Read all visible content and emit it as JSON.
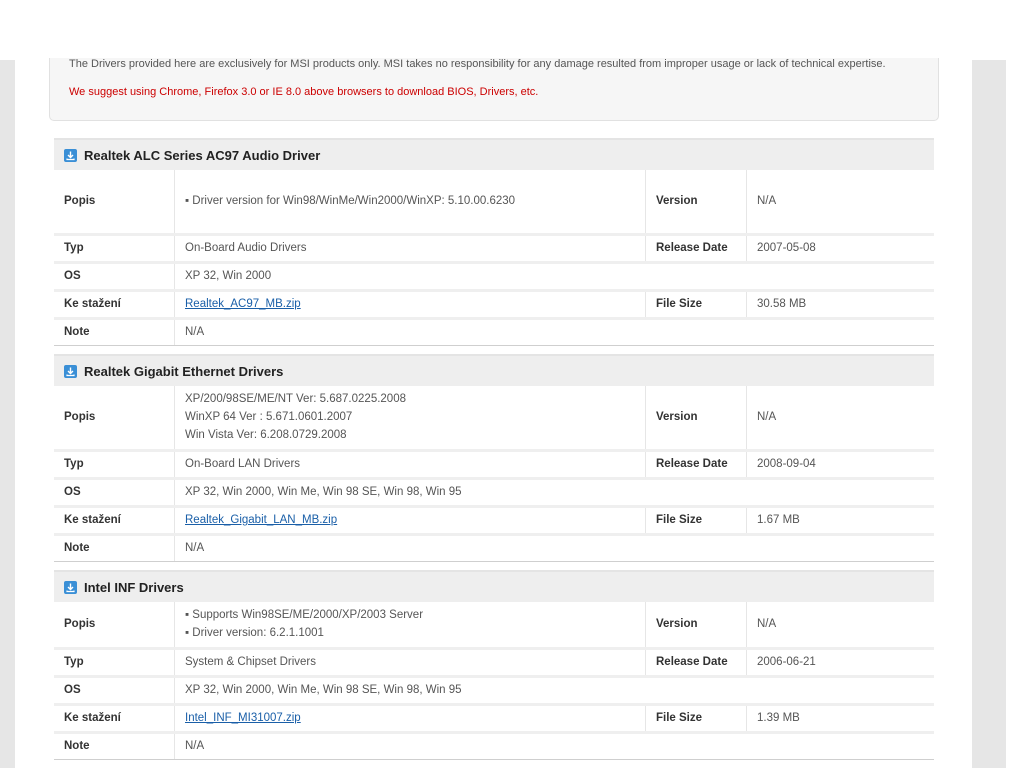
{
  "notice": {
    "disclaimer": "The Drivers provided here are exclusively for MSI products only. MSI takes no responsibility for any damage resulted from improper usage or lack of technical expertise.",
    "browser_tip": "We suggest using Chrome, Firefox 3.0 or IE 8.0 above browsers to download BIOS, Drivers, etc."
  },
  "labels": {
    "description": "Popis",
    "type": "Typ",
    "os": "OS",
    "download": "Ke stažení",
    "note": "Note",
    "version": "Version",
    "release_date": "Release Date",
    "file_size": "File Size"
  },
  "colors": {
    "accent_link": "#1a5fa8",
    "warning_text": "#cc0000",
    "icon_blue": "#3a8fd6"
  },
  "icons": {
    "section": "download-icon"
  },
  "drivers": [
    {
      "title": "Realtek ALC Series AC97 Audio Driver",
      "description": [
        "▪ Driver version for Win98/WinMe/Win2000/WinXP: 5.10.00.6230"
      ],
      "version": "N/A",
      "type": "On-Board Audio Drivers",
      "release_date": "2007-05-08",
      "os": "XP 32, Win 2000",
      "file": "Realtek_AC97_MB.zip",
      "file_size": "30.58 MB",
      "note": "N/A"
    },
    {
      "title": "Realtek Gigabit Ethernet Drivers",
      "description": [
        "XP/200/98SE/ME/NT Ver: 5.687.0225.2008",
        "WinXP 64 Ver : 5.671.0601.2007",
        "Win Vista Ver: 6.208.0729.2008"
      ],
      "version": "N/A",
      "type": "On-Board LAN Drivers",
      "release_date": "2008-09-04",
      "os": "XP 32, Win 2000, Win Me, Win 98 SE, Win 98, Win 95",
      "file": "Realtek_Gigabit_LAN_MB.zip",
      "file_size": "1.67 MB",
      "note": "N/A"
    },
    {
      "title": "Intel INF Drivers",
      "description": [
        "▪ Supports Win98SE/ME/2000/XP/2003 Server",
        "▪ Driver version: 6.2.1.1001"
      ],
      "version": "N/A",
      "type": "System & Chipset Drivers",
      "release_date": "2006-06-21",
      "os": "XP 32, Win 2000, Win Me, Win 98 SE, Win 98, Win 95",
      "file": "Intel_INF_MI31007.zip",
      "file_size": "1.39 MB",
      "note": "N/A"
    }
  ]
}
